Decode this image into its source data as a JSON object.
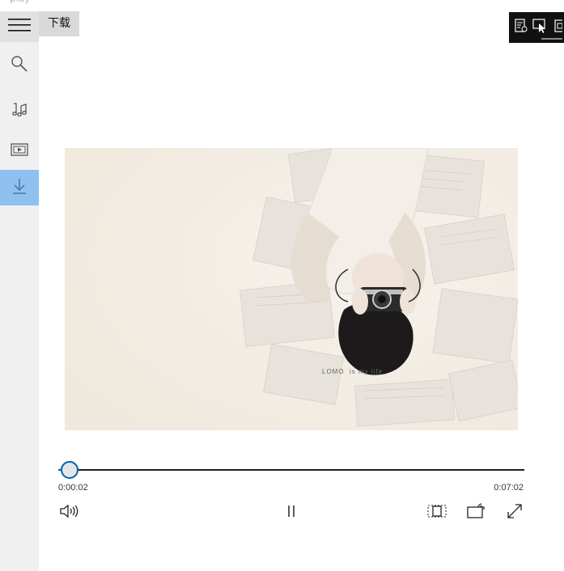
{
  "app": {
    "title": "play"
  },
  "nav": {
    "items": [
      {
        "id": "menu",
        "icon": "hamburger-icon"
      },
      {
        "id": "search",
        "icon": "search-icon"
      },
      {
        "id": "music",
        "icon": "music-note-icon"
      },
      {
        "id": "video",
        "icon": "video-icon"
      },
      {
        "id": "download",
        "icon": "download-icon",
        "selected": true
      }
    ]
  },
  "page": {
    "title": "下载"
  },
  "media": {
    "overlay_text": "LOMO  is my life"
  },
  "player": {
    "elapsed": "0:00:02",
    "total": "0:07:02",
    "progress_fraction": 0.005,
    "state": "playing"
  },
  "colors": {
    "accent": "#0063b1",
    "nav_selected": "#8ec1ef",
    "nav_background": "#f0f0f0",
    "toolbar_background": "#111111"
  }
}
